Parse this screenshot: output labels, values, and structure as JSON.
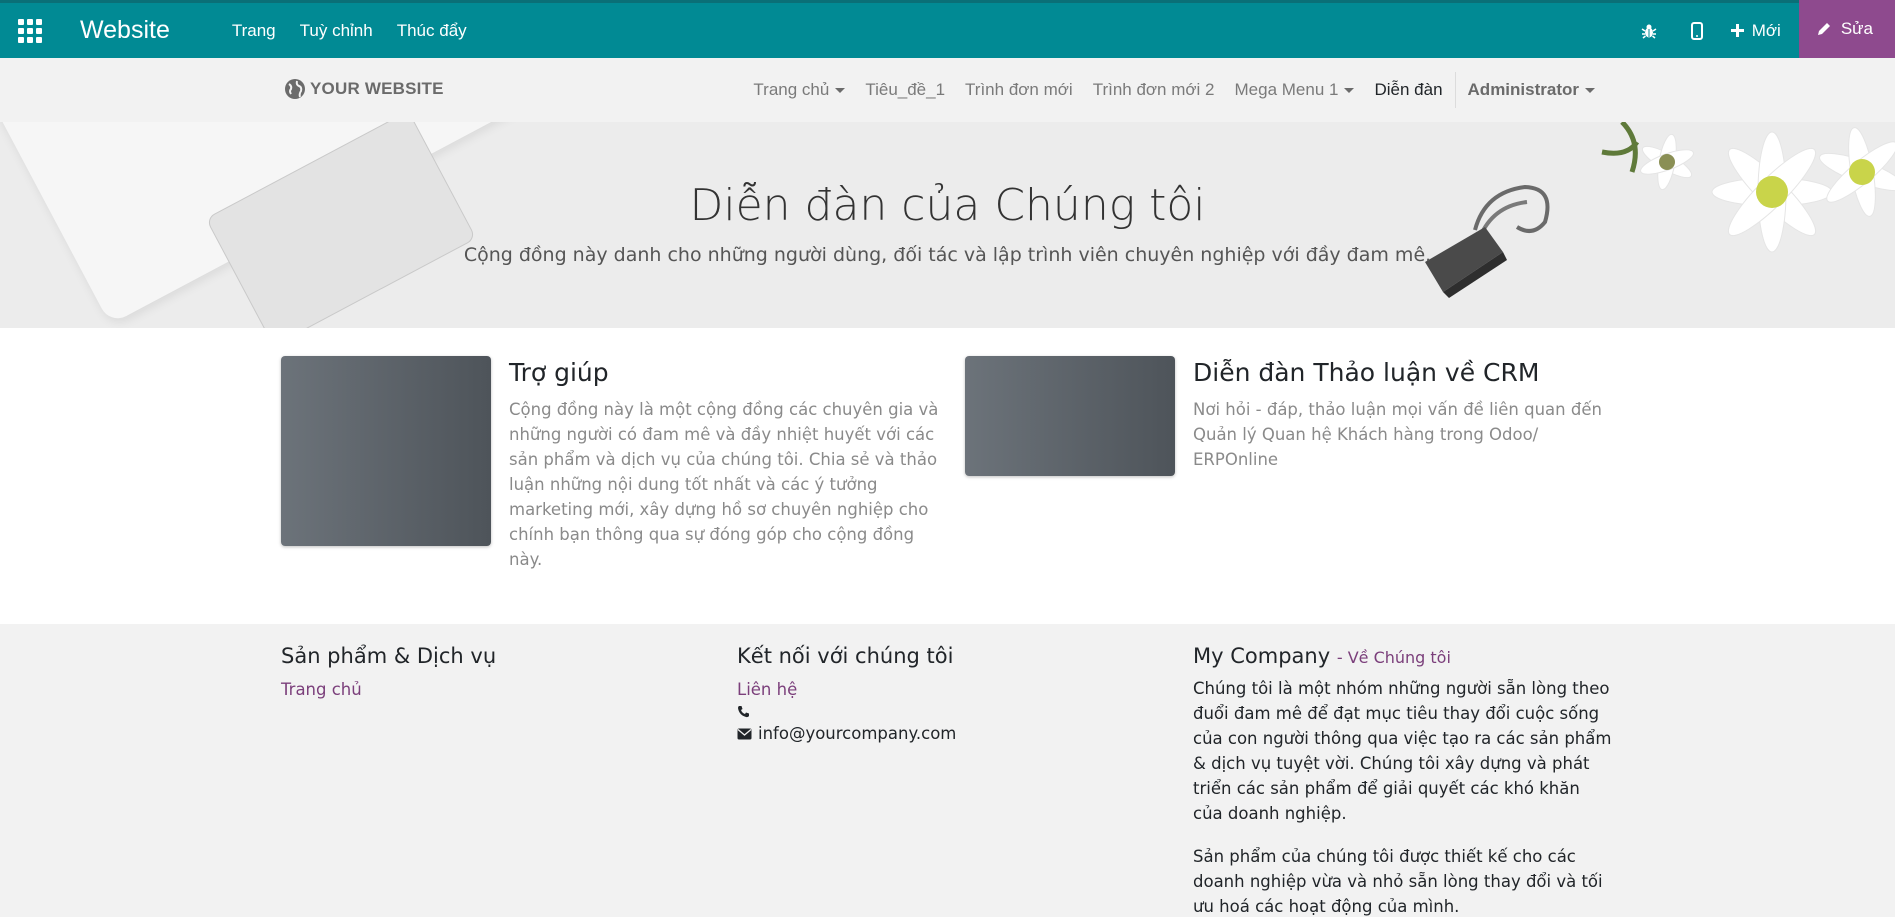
{
  "topbar": {
    "brand": "Website",
    "menu": [
      "Trang",
      "Tuỳ chỉnh",
      "Thúc đẩy"
    ],
    "new_label": "Mới",
    "edit_label": "Sửa",
    "bg_color": "#018a94",
    "edit_color": "#8e4a8e"
  },
  "header": {
    "logo_text": "YOUR WEBSITE",
    "nav": {
      "home": "Trang chủ",
      "title1": "Tiêu_đề_1",
      "menu_new": "Trình đơn mới",
      "menu_new2": "Trình đơn mới 2",
      "mega": "Mega Menu 1",
      "forum": "Diễn đàn",
      "user": "Administrator"
    }
  },
  "hero": {
    "title": "Diễn đàn của Chúng tôi",
    "subtitle": "Cộng đồng này danh cho những người dùng, đối tác và lập trình viên chuyên nghiệp với đầy đam mê."
  },
  "forums": [
    {
      "title": "Trợ giúp",
      "description": "Cộng đồng này là một cộng đồng các chuyên gia và những người có đam mê và đầy nhiệt huyết với các sản phẩm và dịch vụ của chúng tôi. Chia sẻ và thảo luận những nội dung tốt nhất và các ý tưởng marketing mới, xây dựng hồ sơ chuyên nghiệp cho chính bạn thông qua sự đóng góp cho cộng đồng này."
    },
    {
      "title": "Diễn đàn Thảo luận về CRM",
      "description": "Nơi hỏi - đáp, thảo luận mọi vấn đề liên quan đến Quản lý Quan hệ Khách hàng trong Odoo/ ERPOnline"
    }
  ],
  "footer": {
    "col1": {
      "heading": "Sản phẩm & Dịch vụ",
      "link": "Trang chủ"
    },
    "col2": {
      "heading": "Kết nối với chúng tôi",
      "link": "Liên hệ",
      "email": "info@yourcompany.com"
    },
    "col3": {
      "heading": "My Company",
      "about_link": "- Về Chúng tôi",
      "para1": "Chúng tôi là một nhóm những người sẵn lòng theo đuổi đam mê để đạt mục tiêu thay đổi cuộc sống của con người thông qua việc tạo ra các sản phẩm & dịch vụ tuyệt vời. Chúng tôi xây dựng và phát triển các sản phẩm để giải quyết các khó khăn của doanh nghiệp.",
      "para2": "Sản phẩm của chúng tôi được thiết kế cho các doanh nghiệp vừa và nhỏ sẵn lòng thay đổi và tối ưu hoá các hoạt động của mình."
    }
  }
}
